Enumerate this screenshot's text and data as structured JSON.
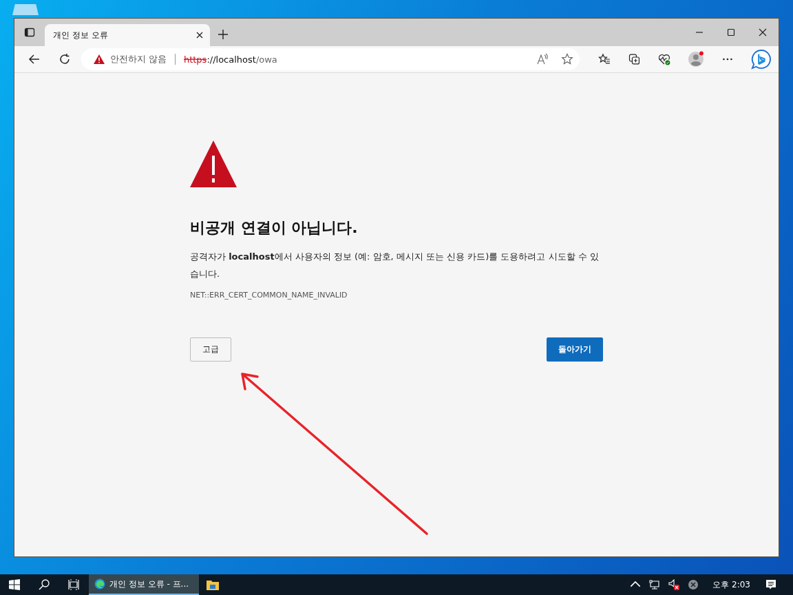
{
  "browser": {
    "tab": {
      "title": "개인 정보 오류",
      "selected": true
    },
    "address_bar": {
      "security_label": "안전하지 않음",
      "scheme": "https",
      "host": "://localhost",
      "path": "/owa"
    }
  },
  "error_page": {
    "heading": "비공개 연결이 아닙니다.",
    "message": "공격자가 **localhost**에서 사용자의 정보 (예: 암호, 메시지 또는 신용 카드)를 도용하려고 시도할 수 있습니다.",
    "error_code": "NET::ERR_CERT_COMMON_NAME_INVALID",
    "buttons": [
      {
        "label": "고급",
        "kind": "secondary"
      },
      {
        "label": "돌아가기",
        "kind": "primary"
      }
    ]
  },
  "taskbar": {
    "apps": [
      {
        "kind": "edge",
        "label": "개인 정보 오류 - 프...",
        "selected": true
      },
      {
        "kind": "explorer",
        "selected": false
      }
    ],
    "clock": "오후 2:03"
  }
}
